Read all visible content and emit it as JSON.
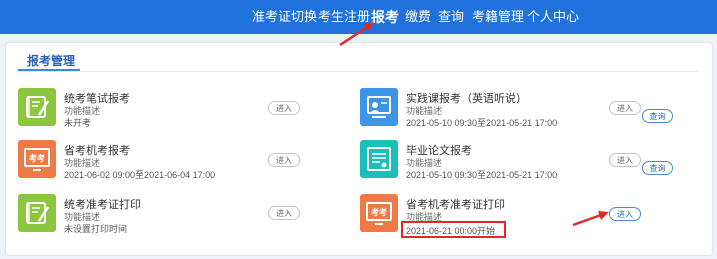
{
  "nav": {
    "items": [
      {
        "label": "准考证切换"
      },
      {
        "label": "考生注册"
      },
      {
        "label": "报考"
      },
      {
        "label": "缴费"
      },
      {
        "label": "查询"
      },
      {
        "label": "考籍管理"
      },
      {
        "label": "个人中心"
      }
    ],
    "active": "报考"
  },
  "section": {
    "tab_title": "报考管理"
  },
  "cards": [
    {
      "title": "统考笔试报考",
      "desc": "功能描述",
      "info": "未开考",
      "button": "进入"
    },
    {
      "title": "实践课报考（英语听说）",
      "desc": "功能描述",
      "info": "2021-05-10 09:30至2021-05-21 17:00",
      "button": "进入",
      "query": "查询"
    },
    {
      "title": "省考机考报考",
      "desc": "功能描述",
      "info": "2021-06-02 09:00至2021-06-04 17:00",
      "button": "进入"
    },
    {
      "title": "毕业论文报考",
      "desc": "功能描述",
      "info": "2021-05-10 09:30至2021-05-21 17:00",
      "button": "进入",
      "query": "查询"
    },
    {
      "title": "统考准考证打印",
      "desc": "功能描述",
      "info": "未设置打印时间",
      "button": "进入"
    },
    {
      "title": "省考机考准考证打印",
      "desc": "功能描述",
      "info": "2021-06-21 00:00开始",
      "button": "进入"
    }
  ],
  "icon_text": {
    "exam_sign": "考考"
  },
  "colors": {
    "topbar": "#1f72dc",
    "icon_green": "#8cc63f",
    "icon_orange": "#f07a45",
    "icon_blue": "#3d95e8",
    "icon_teal": "#1bbfb7",
    "highlight_red": "#e02a2a"
  },
  "icons": [
    "book-pen-icon",
    "presentation-icon",
    "computer-exam-icon",
    "certificate-icon",
    "book-pen-icon",
    "computer-exam-icon"
  ]
}
